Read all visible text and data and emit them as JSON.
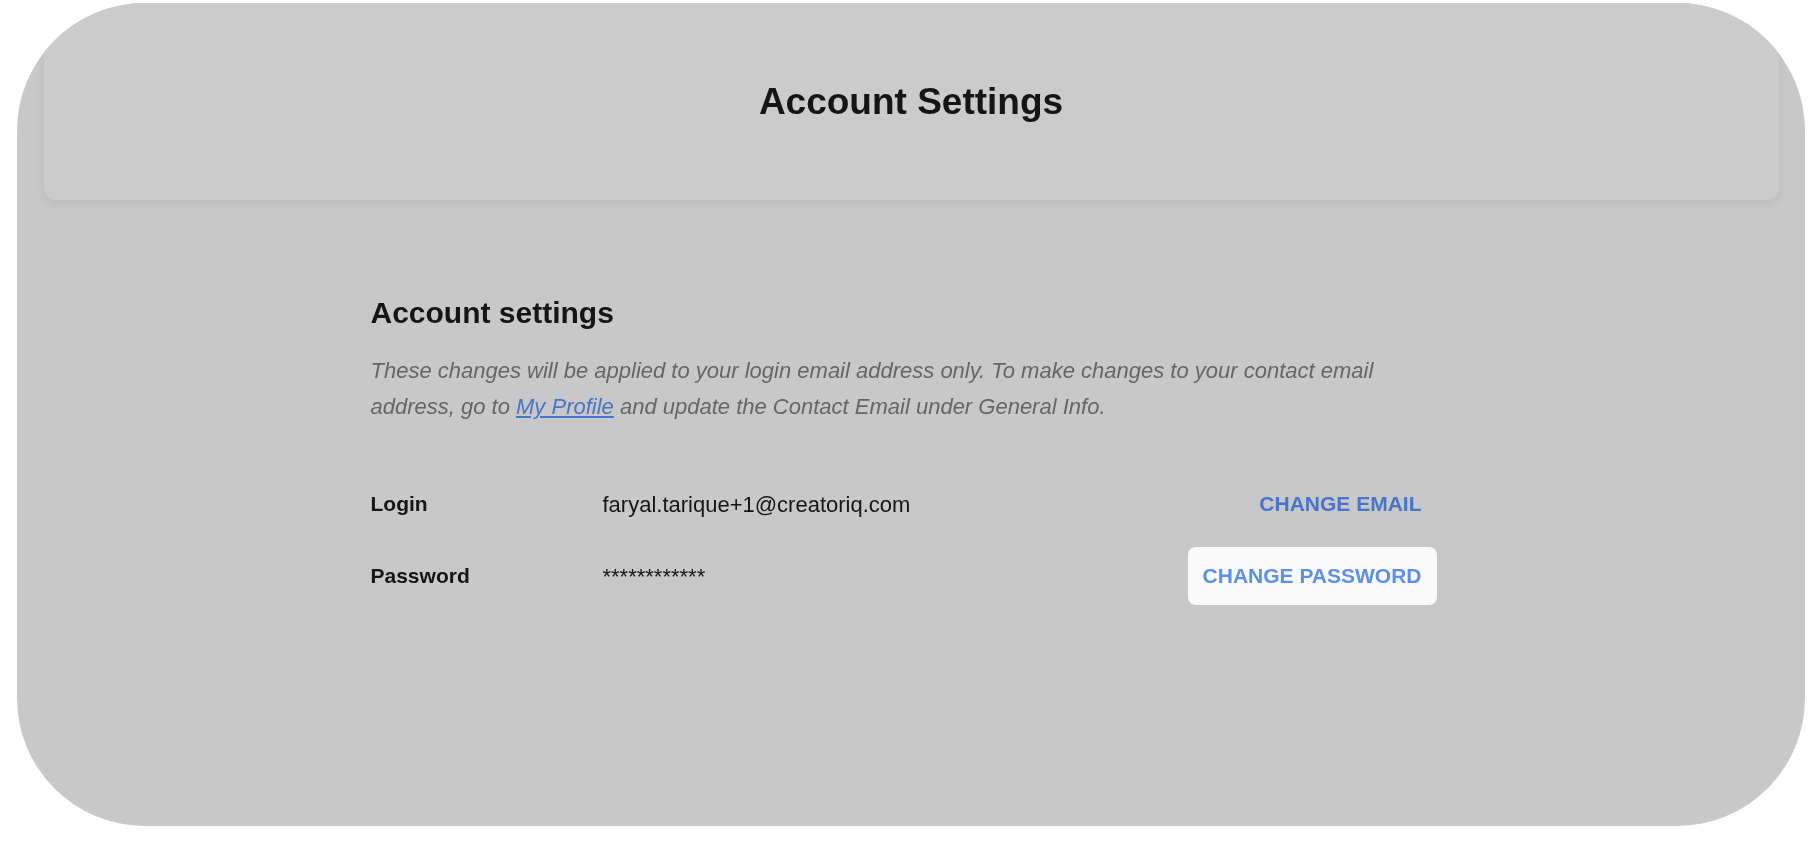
{
  "header": {
    "title": "Account Settings"
  },
  "section": {
    "heading": "Account settings",
    "description": "These changes will be applied to your login email address only. To make changes to your contact email address, go to ",
    "link": "My Profile",
    "description_after": " and update the Contact Email under General Info."
  },
  "rows": [
    {
      "label": "Login",
      "value": "faryal.tarique+1@creatoriq.com",
      "action": "CHANGE EMAIL",
      "highlighted": false
    },
    {
      "label": "Password",
      "value": "************",
      "action": "CHANGE PASSWORD",
      "highlighted": true
    }
  ]
}
